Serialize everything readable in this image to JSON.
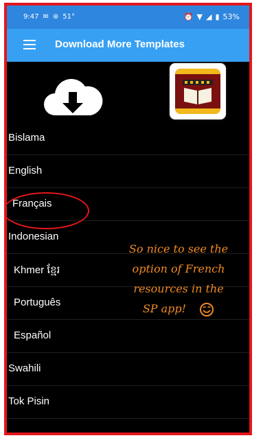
{
  "status_bar": {
    "time": "9:47",
    "temperature": "51°",
    "battery": "53%"
  },
  "app_bar": {
    "title": "Download More Templates"
  },
  "languages": [
    {
      "label": "Bislama"
    },
    {
      "label": "English"
    },
    {
      "label": "Français"
    },
    {
      "label": "Indonesian"
    },
    {
      "label": "Khmer ខ្មែរ"
    },
    {
      "label": "Português"
    },
    {
      "label": "Español"
    },
    {
      "label": "Swahili"
    },
    {
      "label": "Tok Pisin"
    }
  ],
  "annotation": {
    "line1": "So nice to see the",
    "line2": "option of French",
    "line3": "resources in the",
    "line4": "SP app!"
  },
  "colors": {
    "frame_border": "#e3161b",
    "status_bar": "#2e86de",
    "app_bar": "#37a0f2",
    "annotation_text": "#f08a24"
  }
}
